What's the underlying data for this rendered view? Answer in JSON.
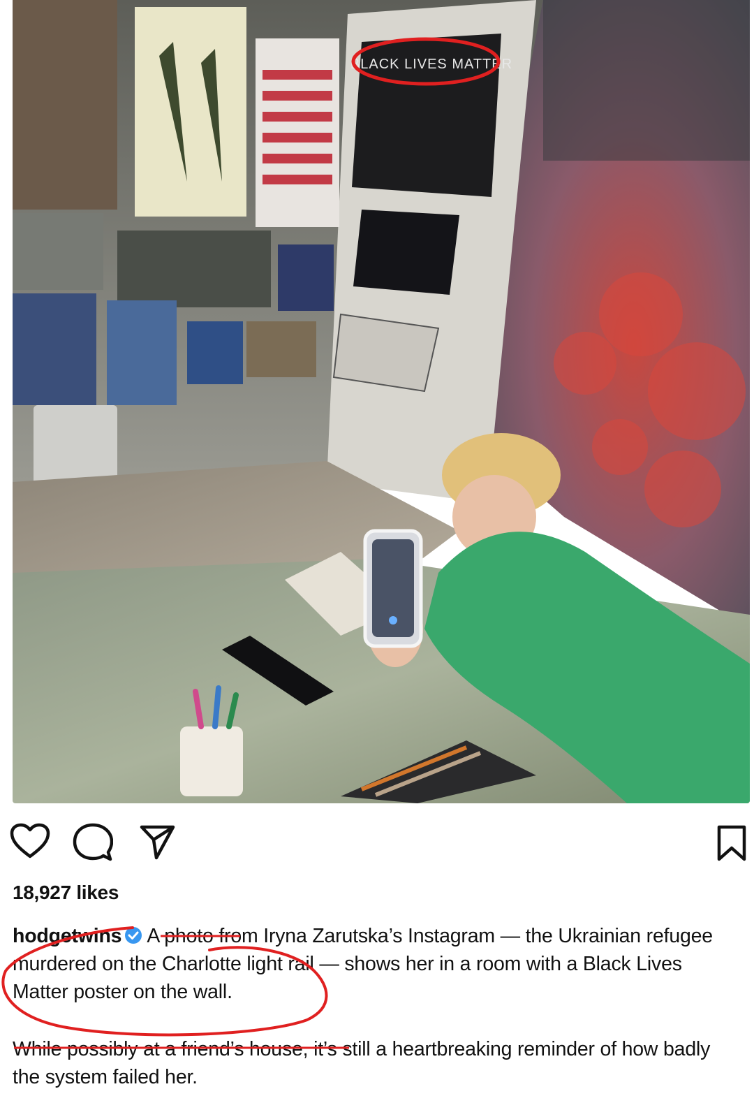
{
  "post": {
    "photo_poster_text": "BLACK LIVES MATTER",
    "likes_text": "18,927 likes",
    "username": "hodgetwins",
    "caption_paragraph_1": "A photo from Iryna Zarutska’s Instagram — the Ukrainian refugee murdered on the Charlotte light rail — shows her in a room with a Black Lives Matter poster on the wall.",
    "caption_paragraph_2": "While possibly at a friend’s house, it’s still a heartbreaking reminder of how badly the system failed her."
  },
  "actions": {
    "like_icon": "heart-icon",
    "comment_icon": "comment-icon",
    "share_icon": "share-icon",
    "save_icon": "bookmark-icon"
  },
  "colors": {
    "annotation_red": "#e02020",
    "verified_blue": "#3897f0",
    "shirt_green": "#3aa86c"
  }
}
